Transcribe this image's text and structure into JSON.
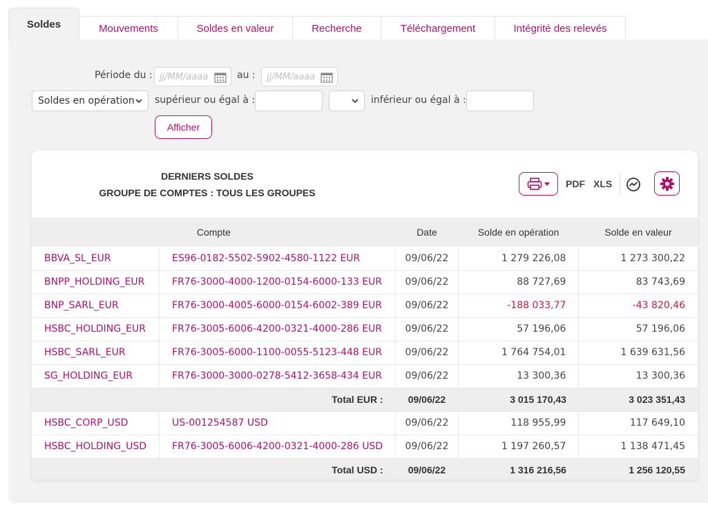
{
  "tabs": [
    {
      "label": "Soldes",
      "active": true
    },
    {
      "label": "Mouvements"
    },
    {
      "label": "Soldes en valeur"
    },
    {
      "label": "Recherche"
    },
    {
      "label": "Téléchargement"
    },
    {
      "label": "Intégrité des relevés"
    }
  ],
  "filters": {
    "period_label": "Période du :",
    "date_from_placeholder": "jj/MM/aaaa",
    "to_label": "au :",
    "date_to_placeholder": "jj/MM/aaaa",
    "balance_type_value": "Soldes en opération",
    "gte_label": "supérieur ou égal à :",
    "lte_label": "inférieur ou égal à :",
    "submit_label": "Afficher"
  },
  "report": {
    "title": "DERNIERS SOLDES",
    "subtitle": "GROUPE DE COMPTES : TOUS LES GROUPES",
    "pdf_label": "PDF",
    "xls_label": "XLS"
  },
  "table": {
    "headers": {
      "account": "Compte",
      "date": "Date",
      "op_balance": "Solde en opération",
      "value_balance": "Solde en valeur"
    },
    "rows": [
      {
        "name": "BBVA_SL_EUR",
        "iban": "ES96-0182-5502-5902-4580-1122 EUR",
        "date": "09/06/22",
        "op": "1 279 226,08",
        "val": "1 273 300,22"
      },
      {
        "name": "BNPP_HOLDING_EUR",
        "iban": "FR76-3000-4000-1200-0154-6000-133 EUR",
        "date": "09/06/22",
        "op": "88 727,69",
        "val": "83 743,69"
      },
      {
        "name": "BNP_SARL_EUR",
        "iban": "FR76-3000-4005-6000-0154-6002-389 EUR",
        "date": "09/06/22",
        "op": "-188 033,77",
        "val": "-43 820,46"
      },
      {
        "name": "HSBC_HOLDING_EUR",
        "iban": "FR76-3005-6006-4200-0321-4000-286 EUR",
        "date": "09/06/22",
        "op": "57 196,06",
        "val": "57 196,06"
      },
      {
        "name": "HSBC_SARL_EUR",
        "iban": "FR76-3005-6000-1100-0055-5123-448 EUR",
        "date": "09/06/22",
        "op": "1 764 754,01",
        "val": "1 639 631,56"
      },
      {
        "name": "SG_HOLDING_EUR",
        "iban": "FR76-3000-3000-0278-5412-3658-434 EUR",
        "date": "09/06/22",
        "op": "13 300,36",
        "val": "13 300,36"
      }
    ],
    "total_eur": {
      "label": "Total EUR :",
      "date": "09/06/22",
      "op": "3 015 170,43",
      "val": "3 023 351,43"
    },
    "rows_usd": [
      {
        "name": "HSBC_CORP_USD",
        "iban": "US-001254587 USD",
        "date": "09/06/22",
        "op": "118 955,99",
        "val": "117 649,10"
      },
      {
        "name": "HSBC_HOLDING_USD",
        "iban": "FR76-3005-6006-4200-0321-4000-286 USD",
        "date": "09/06/22",
        "op": "1 197 260,57",
        "val": "1 138 471,45"
      }
    ],
    "total_usd": {
      "label": "Total USD :",
      "date": "09/06/22",
      "op": "1 316 216,56",
      "val": "1 256 120,55"
    }
  },
  "colors": {
    "accent": "#b0106e",
    "negative": "#cc1a3a",
    "panel": "#f2f2f2"
  }
}
